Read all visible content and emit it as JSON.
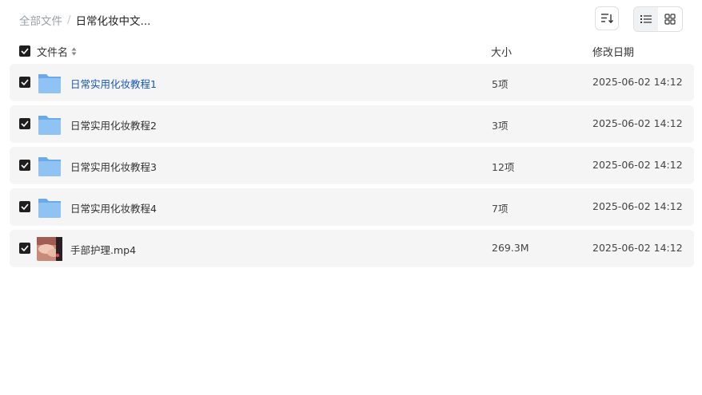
{
  "breadcrumb": {
    "root": "全部文件",
    "separator": "/",
    "current": "日常化妆中文..."
  },
  "toolbar": {
    "sort_icon": "sort-icon",
    "list_view_icon": "list-icon",
    "grid_view_icon": "grid-icon"
  },
  "columns": {
    "name": "文件名",
    "size": "大小",
    "modified": "修改日期"
  },
  "files": [
    {
      "name": "日常实用化妆教程1",
      "size": "5项",
      "modified": "2025-06-02 14:12",
      "type": "folder",
      "hovered": true
    },
    {
      "name": "日常实用化妆教程2",
      "size": "3项",
      "modified": "2025-06-02 14:12",
      "type": "folder"
    },
    {
      "name": "日常实用化妆教程3",
      "size": "12项",
      "modified": "2025-06-02 14:12",
      "type": "folder"
    },
    {
      "name": "日常实用化妆教程4",
      "size": "7项",
      "modified": "2025-06-02 14:12",
      "type": "folder"
    },
    {
      "name": "手部护理.mp4",
      "size": "269.3M",
      "modified": "2025-06-02 14:12",
      "type": "video"
    }
  ],
  "colors": {
    "link": "#1a56b8",
    "row_bg": "#f5f5f6",
    "folder": "#7fb8f0",
    "checkbox": "#1f1f1f"
  }
}
